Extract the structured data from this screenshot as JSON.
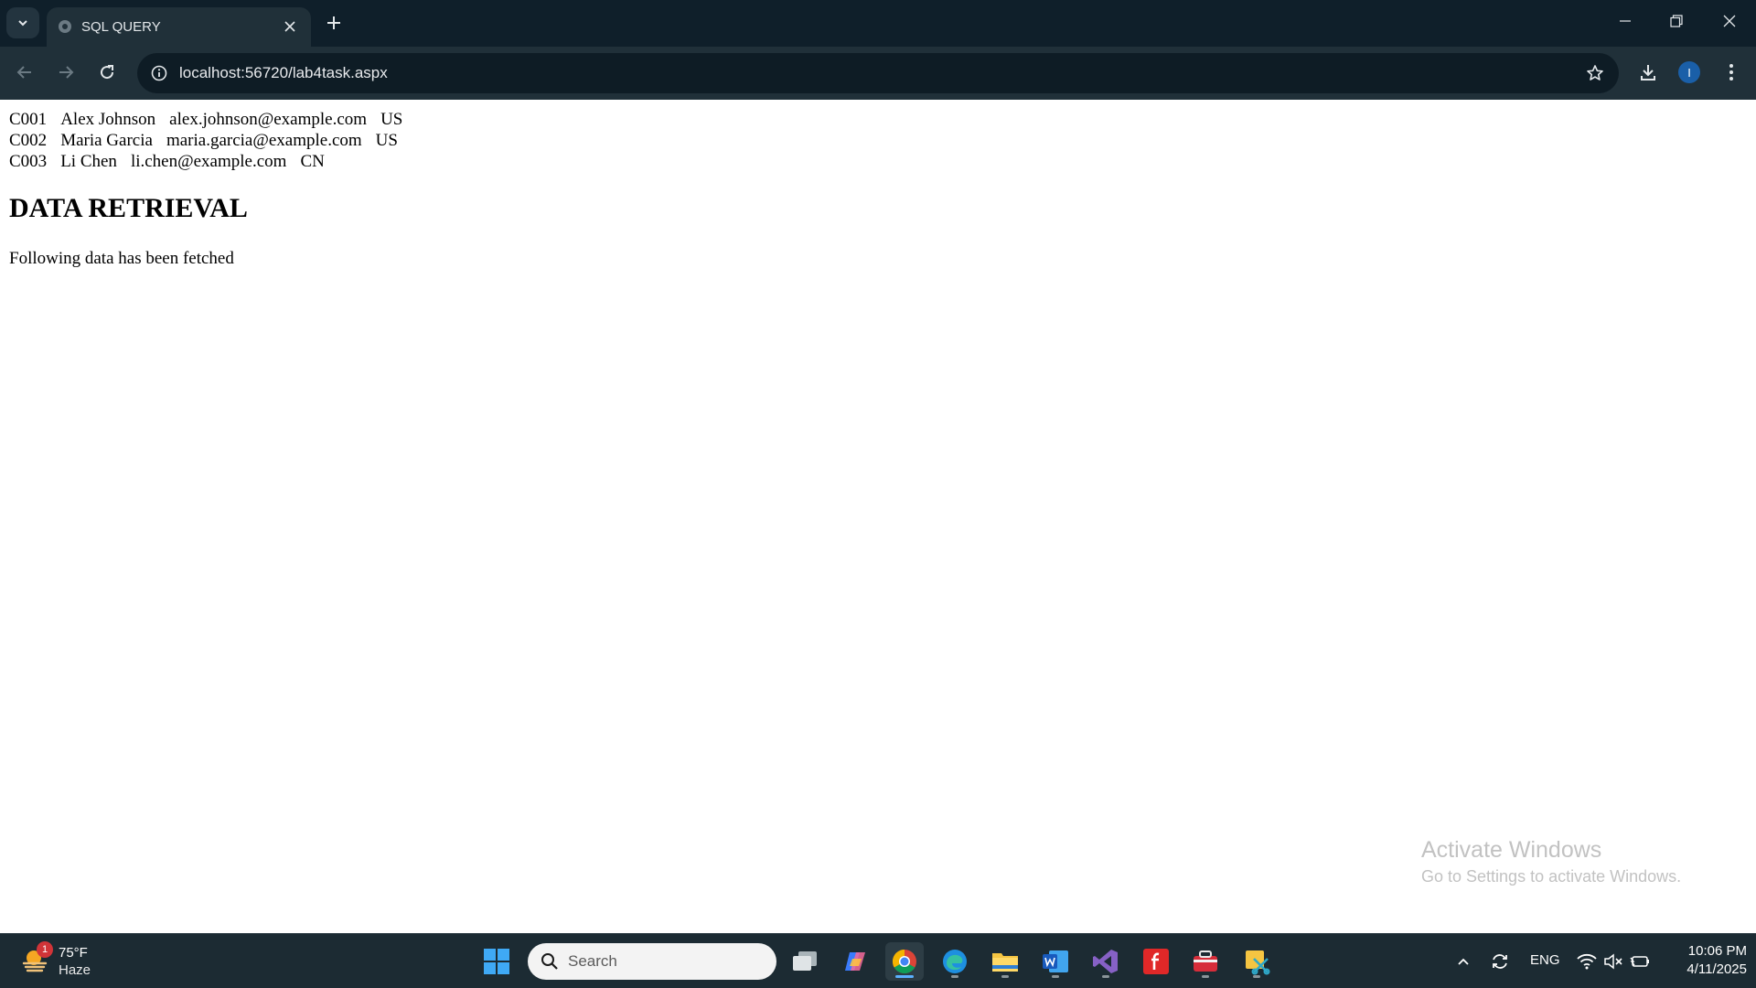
{
  "browser": {
    "tab_title": "SQL QUERY",
    "url": "localhost:56720/lab4task.aspx",
    "profile_initial": "I"
  },
  "page": {
    "rows": [
      {
        "id": "C001",
        "name": "Alex Johnson",
        "email": "alex.johnson@example.com",
        "country": "US"
      },
      {
        "id": "C002",
        "name": "Maria Garcia",
        "email": "maria.garcia@example.com",
        "country": "US"
      },
      {
        "id": "C003",
        "name": "Li Chen",
        "email": "li.chen@example.com",
        "country": "CN"
      }
    ],
    "heading": "DATA RETRIEVAL",
    "subtext": "Following data has been fetched"
  },
  "watermark": {
    "title": "Activate Windows",
    "subtitle": "Go to Settings to activate Windows."
  },
  "taskbar": {
    "weather": {
      "temp": "75°F",
      "condition": "Haze",
      "badge": "1"
    },
    "search_placeholder": "Search",
    "language": "ENG",
    "time": "10:06 PM",
    "date": "4/11/2025"
  },
  "colors": {
    "chrome_dark": "#0f1f2a",
    "chrome_toolbar": "#203039",
    "taskbar": "#1c2b33",
    "accent_blue": "#5bb0ff"
  }
}
